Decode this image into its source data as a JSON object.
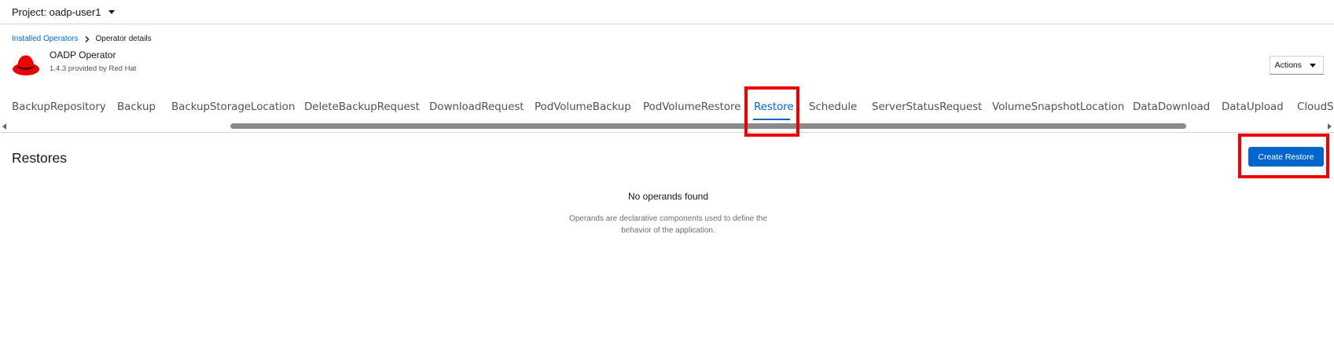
{
  "project": {
    "label": "Project: oadp-user1"
  },
  "breadcrumb": {
    "items": [
      {
        "label": "Installed Operators"
      },
      {
        "label": "Operator details"
      }
    ]
  },
  "operator": {
    "name": "OADP Operator",
    "version": "1.4.3 provided by Red Hat"
  },
  "actions": {
    "label": "Actions"
  },
  "tabs": [
    {
      "label": "BackupRepository"
    },
    {
      "label": "Backup"
    },
    {
      "label": "BackupStorageLocation"
    },
    {
      "label": "DeleteBackupRequest"
    },
    {
      "label": "DownloadRequest"
    },
    {
      "label": "PodVolumeBackup"
    },
    {
      "label": "PodVolumeRestore"
    },
    {
      "label": "Restore"
    },
    {
      "label": "Schedule"
    },
    {
      "label": "ServerStatusRequest"
    },
    {
      "label": "VolumeSnapshotLocation"
    },
    {
      "label": "DataDownload"
    },
    {
      "label": "DataUpload"
    },
    {
      "label": "CloudSt"
    }
  ],
  "section": {
    "title": "Restores",
    "create_label": "Create Restore"
  },
  "empty": {
    "title": "No operands found",
    "desc_line1": "Operands are declarative components used to define the",
    "desc_line2": "behavior of the application."
  },
  "colors": {
    "accent": "#0066cc",
    "highlight": "#ee0000",
    "logo": "#ee0000"
  }
}
